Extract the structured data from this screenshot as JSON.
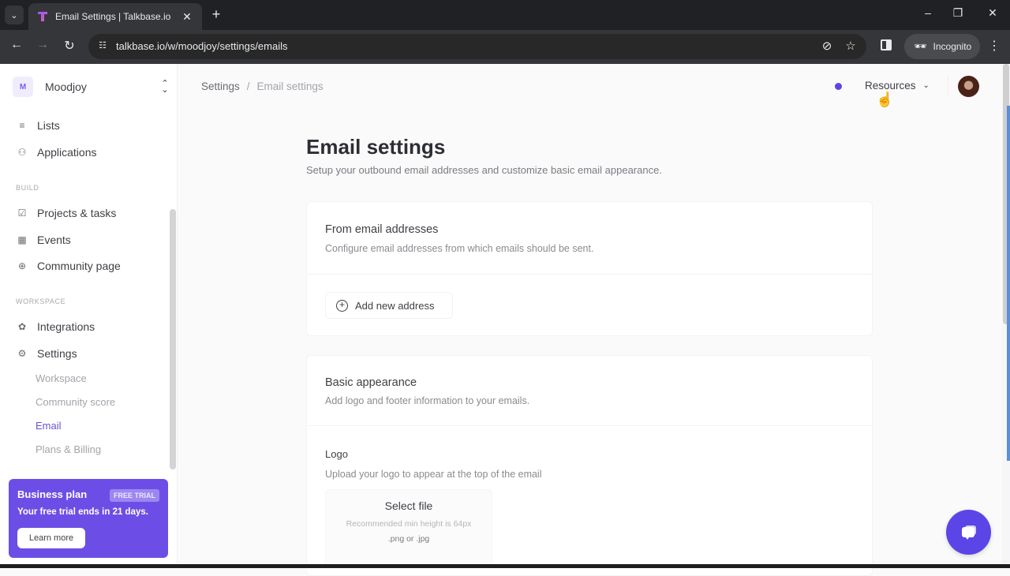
{
  "browser": {
    "tab_title": "Email Settings | Talkbase.io",
    "url": "talkbase.io/w/moodjoy/settings/emails",
    "incognito_label": "Incognito",
    "icons": {
      "tab_search": "chevron-down-icon",
      "tab_close": "close-icon",
      "new_tab": "plus-icon",
      "back": "arrow-left-icon",
      "forward": "arrow-right-icon",
      "reload": "reload-icon",
      "site_info": "tune-icon",
      "eye_off": "eye-off-icon",
      "bookmark": "star-icon",
      "side_panel": "side-panel-icon",
      "incognito": "incognito-icon",
      "menu": "kebab-menu-icon",
      "minimize": "minimize-icon",
      "restore": "restore-icon",
      "close_window": "close-icon"
    },
    "glyphs": {
      "tab_search": "⌄",
      "tab_close": "✕",
      "new_tab": "+",
      "back": "←",
      "forward": "→",
      "reload": "↻",
      "site_info": "☷",
      "eye_off": "⊘",
      "bookmark": "☆",
      "incognito": "🕶",
      "menu": "⋮",
      "minimize": "–",
      "restore": "❐",
      "close_window": "✕"
    }
  },
  "sidebar": {
    "workspace": {
      "initial": "M",
      "name": "Moodjoy",
      "chevron": "⌃⌄"
    },
    "items_top": [
      {
        "label": "Lists",
        "icon": "list-icon",
        "glyph": "≡"
      },
      {
        "label": "Applications",
        "icon": "user-plus-icon",
        "glyph": "⚇"
      }
    ],
    "sections": [
      {
        "label": "BUILD",
        "items": [
          {
            "label": "Projects & tasks",
            "icon": "checkbox-icon",
            "glyph": "☑"
          },
          {
            "label": "Events",
            "icon": "calendar-icon",
            "glyph": "▦"
          },
          {
            "label": "Community page",
            "icon": "globe-icon",
            "glyph": "⊕"
          }
        ]
      },
      {
        "label": "WORKSPACE",
        "items": [
          {
            "label": "Integrations",
            "icon": "puzzle-icon",
            "glyph": "✿"
          },
          {
            "label": "Settings",
            "icon": "gear-icon",
            "glyph": "⚙"
          }
        ]
      }
    ],
    "settings_sub": [
      {
        "label": "Workspace",
        "active": false
      },
      {
        "label": "Community score",
        "active": false
      },
      {
        "label": "Email",
        "active": true
      },
      {
        "label": "Plans & Billing",
        "active": false
      }
    ],
    "plan_card": {
      "title": "Business plan",
      "badge": "FREE TRIAL",
      "text": "Your free trial ends in 21 days.",
      "button": "Learn more"
    }
  },
  "topbar": {
    "breadcrumb": [
      "Settings",
      "Email settings"
    ],
    "separator": "/",
    "resources_label": "Resources",
    "resources_chevron": "⌄",
    "cursor": "☝"
  },
  "main": {
    "title": "Email settings",
    "subtitle": "Setup your outbound email addresses and customize basic email appearance.",
    "from_card": {
      "title": "From email addresses",
      "description": "Configure email addresses from which emails should be sent.",
      "add_button": "Add new address",
      "add_icon": "+"
    },
    "appearance_card": {
      "title": "Basic appearance",
      "description": "Add logo and footer information to your emails.",
      "logo": {
        "label": "Logo",
        "description": "Upload your logo to appear at the top of the email",
        "select_label": "Select file",
        "hint": "Recommended min height is 64px",
        "types": ".png or .jpg"
      }
    }
  },
  "colors": {
    "accent": "#5b45e6",
    "plan_card": "#6c4ee6",
    "active_nav": "#6a53d8"
  }
}
